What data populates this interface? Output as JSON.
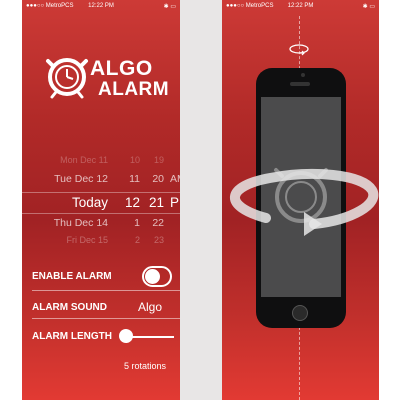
{
  "left_screen": {
    "status": {
      "carrier": "●●●○○ MetroPCS",
      "time": "12:22 PM",
      "right_icons": "✱ ▭"
    },
    "logo": {
      "line1": "ALGO",
      "line2": "ALARM"
    },
    "picker": {
      "rows": [
        {
          "date": "Mon Dec 11",
          "hour": "10",
          "minute": "19",
          "ampm": ""
        },
        {
          "date": "Tue Dec 12",
          "hour": "11",
          "minute": "20",
          "ampm": "AM"
        },
        {
          "date": "Today",
          "hour": "12",
          "minute": "21",
          "ampm": "PM"
        },
        {
          "date": "Thu Dec 14",
          "hour": "1",
          "minute": "22",
          "ampm": ""
        },
        {
          "date": "Fri Dec 15",
          "hour": "2",
          "minute": "23",
          "ampm": ""
        }
      ]
    },
    "settings": {
      "enable_alarm_label": "ENABLE ALARM",
      "enable_alarm_on": true,
      "alarm_sound_label": "ALARM SOUND",
      "alarm_sound_value": "Algo",
      "alarm_length_label": "ALARM LENGTH",
      "alarm_length_fraction": 0.0,
      "rotations_text": "5 rotations"
    }
  },
  "right_screen": {
    "status": {
      "carrier": "●●●○○ MetroPCS",
      "time": "12:22 PM",
      "right_icons": "✱ ▭"
    }
  },
  "colors": {
    "gradient_top": "#cd3a36",
    "gradient_mid": "#a12224",
    "gradient_bottom": "#e23a33",
    "text": "#ffffff",
    "phone_body": "#0f0f10",
    "phone_screen": "#4b4b4c"
  }
}
